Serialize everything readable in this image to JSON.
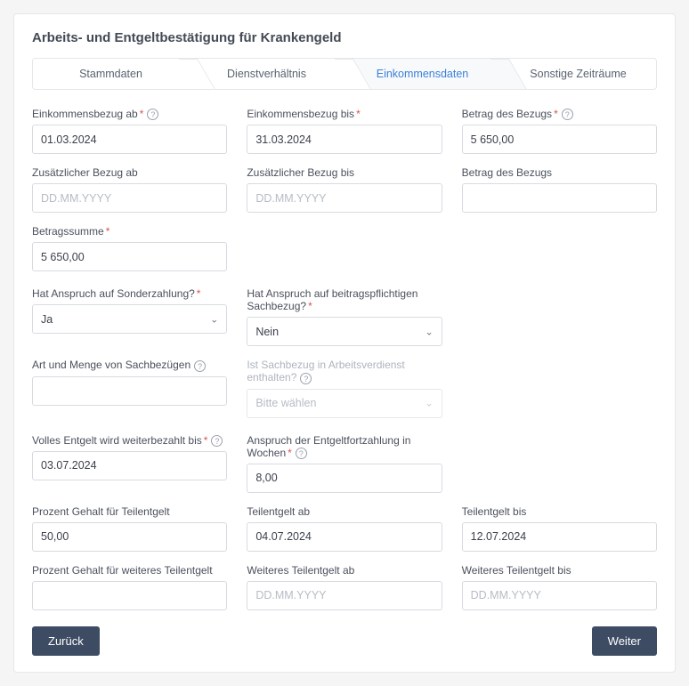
{
  "title": "Arbeits- und Entgeltbestätigung für Krankengeld",
  "tabs": [
    "Stammdaten",
    "Dienstverhältnis",
    "Einkommensdaten",
    "Sonstige Zeiträume"
  ],
  "labels": {
    "einkommen_ab": "Einkommensbezug ab",
    "einkommen_bis": "Einkommensbezug bis",
    "betrag_bezug": "Betrag des Bezugs",
    "zus_ab": "Zusätzlicher Bezug ab",
    "zus_bis": "Zusätzlicher Bezug bis",
    "betrag_bezug2": "Betrag des Bezugs",
    "betragssumme": "Betragssumme",
    "sonderzahlung": "Hat Anspruch auf Sonderzahlung?",
    "sachbezug_pflichtig": "Hat Anspruch auf beitragspflichtigen Sachbezug?",
    "art_sachbezug": "Art und Menge von Sachbezügen",
    "sachbezug_enthalten": "Ist Sachbezug in Arbeitsverdienst enthalten?",
    "volles_entgelt": "Volles Entgelt wird weiterbezahlt bis",
    "anspruch_wochen": "Anspruch der Entgeltfortzahlung in Wochen",
    "prozent_teil": "Prozent Gehalt für Teilentgelt",
    "teilentgelt_ab": "Teilentgelt ab",
    "teilentgelt_bis": "Teilentgelt bis",
    "prozent_weiteres": "Prozent Gehalt für weiteres Teilentgelt",
    "weiteres_ab": "Weiteres Teilentgelt ab",
    "weiteres_bis": "Weiteres Teilentgelt bis"
  },
  "values": {
    "einkommen_ab": "01.03.2024",
    "einkommen_bis": "31.03.2024",
    "betrag_bezug": "5 650,00",
    "betragssumme": "5 650,00",
    "sonderzahlung": "Ja",
    "sachbezug_pflichtig": "Nein",
    "sachbezug_enthalten_ph": "Bitte wählen",
    "volles_entgelt": "03.07.2024",
    "anspruch_wochen": "8,00",
    "prozent_teil": "50,00",
    "teilentgelt_ab": "04.07.2024",
    "teilentgelt_bis": "12.07.2024"
  },
  "placeholders": {
    "date": "DD.MM.YYYY"
  },
  "buttons": {
    "back": "Zurück",
    "next": "Weiter"
  }
}
